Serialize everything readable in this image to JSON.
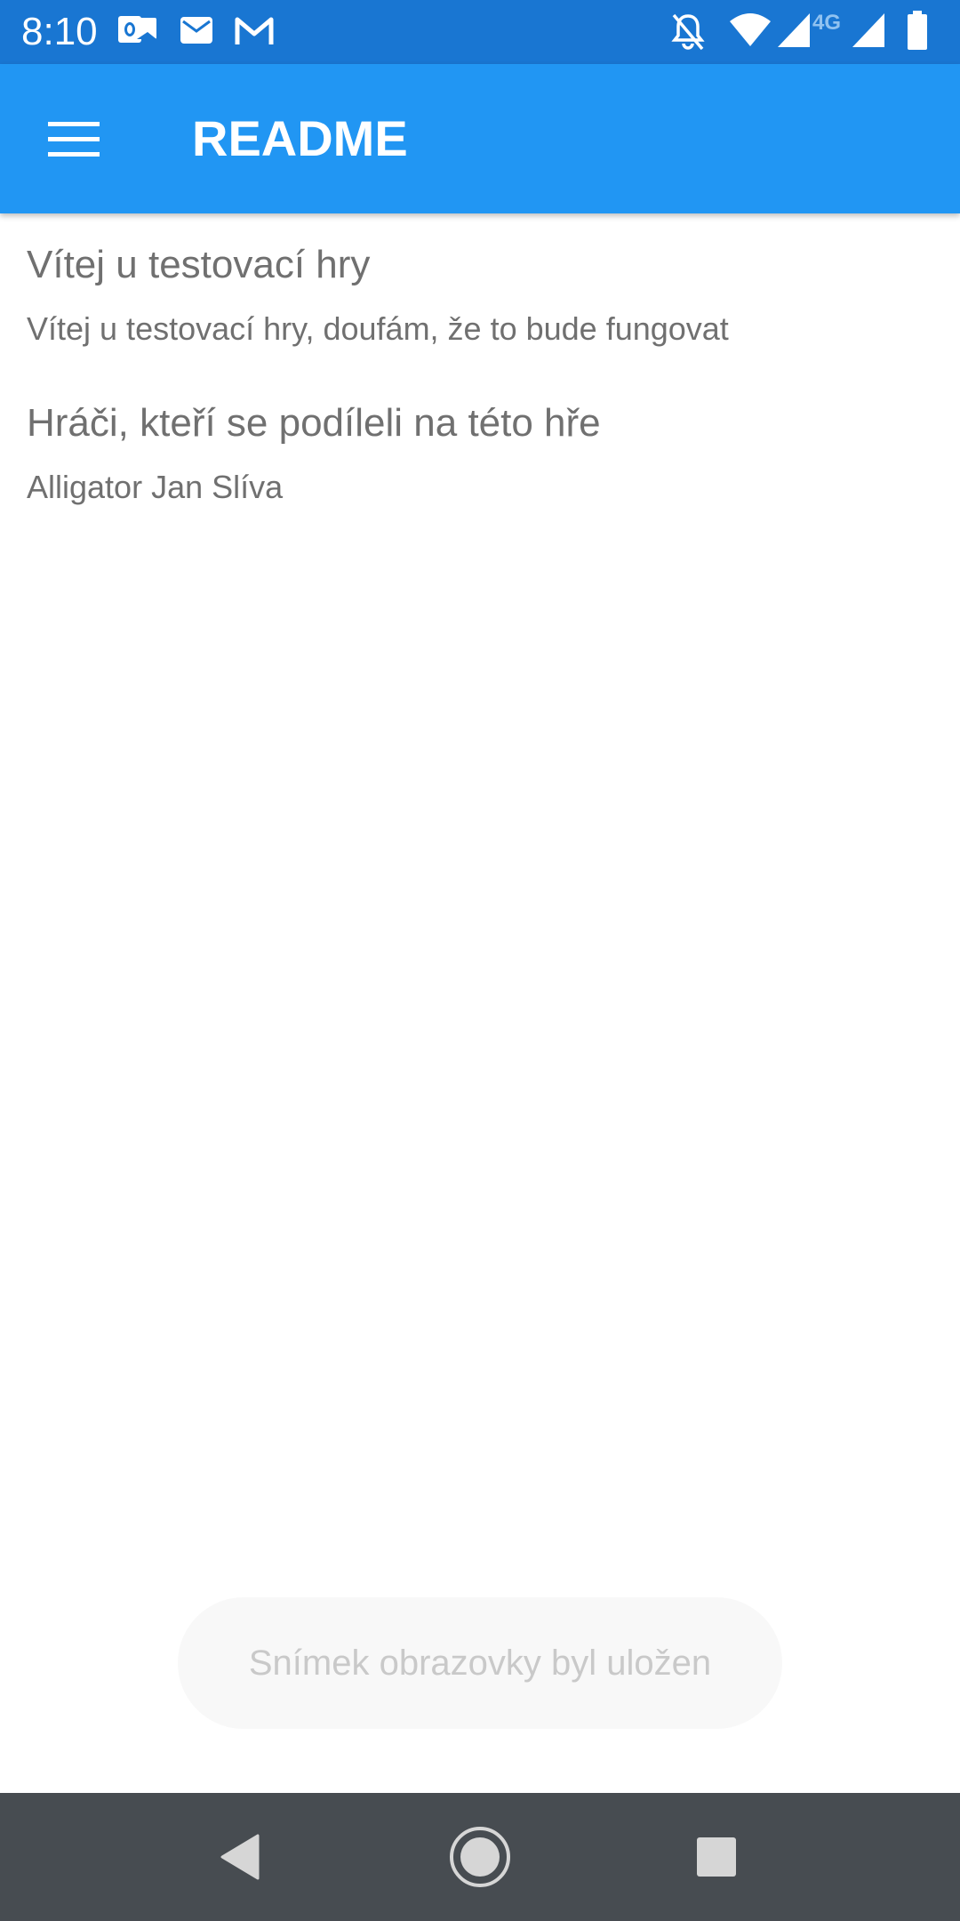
{
  "status_bar": {
    "time": "8:10",
    "left_icons": [
      "outlook-icon",
      "mail-icon",
      "gmail-icon"
    ],
    "right_icons": [
      "bell-off-icon",
      "wifi-icon",
      "signal-icon",
      "signal-4g-icon",
      "battery-icon"
    ],
    "network_label": "4G"
  },
  "app_bar": {
    "title": "README",
    "menu_icon": "hamburger-menu-icon",
    "color": "#2196f3"
  },
  "content": {
    "sections": [
      {
        "heading": "Vítej u testovací hry",
        "text": "Vítej u testovací hry, doufám, že to bude fungovat"
      },
      {
        "heading": "Hráči, kteří se podíleli na této hře",
        "text": "Alligator Jan Slíva"
      }
    ]
  },
  "toast": {
    "message": "Snímek obrazovky byl uložen"
  },
  "nav_bar": {
    "buttons": [
      "back-icon",
      "home-icon",
      "recents-icon"
    ]
  }
}
